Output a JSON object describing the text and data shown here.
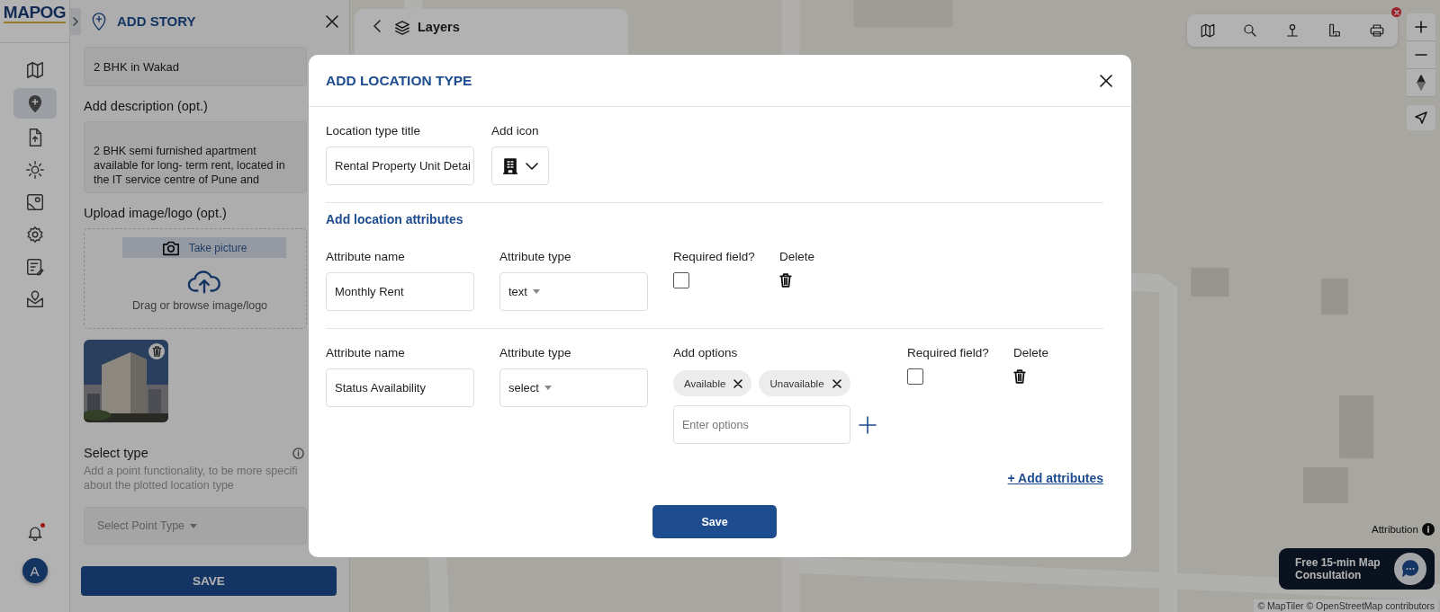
{
  "brand": {
    "logo": "MAPOG"
  },
  "rail": {
    "items": [
      {
        "selected": false
      },
      {
        "selected": true
      },
      {
        "selected": false
      },
      {
        "selected": false
      },
      {
        "selected": false
      },
      {
        "selected": false
      },
      {
        "selected": false
      },
      {
        "selected": false
      }
    ],
    "notifications": {
      "unread": true
    },
    "avatar": "A"
  },
  "story_panel": {
    "title": "ADD STORY",
    "name_value": "2 BHK in Wakad",
    "description_label": "Add description (opt.)",
    "description_value": "2 BHK semi furnished apartment available for long- term rent, located in the IT service centre of Pune and",
    "upload_label": "Upload image/logo (opt.)",
    "take_picture": "Take picture",
    "drop_hint": "Drag or browse image/logo",
    "select_type_label": "Select type",
    "select_type_hint": "Add a point functionality, to be more specifi\nabout the plotted location type",
    "select_placeholder": "Select Point Type",
    "save": "SAVE"
  },
  "layers_panel": {
    "title": "Layers"
  },
  "map": {
    "attribution": "Attribution",
    "consultation": "Free 15-min Map Consultation",
    "copyright": "© MapTiler © OpenStreetMap contributors"
  },
  "modal": {
    "title": "ADD LOCATION TYPE",
    "title_label": "Location type title",
    "title_value": "Rental Property Unit Detai",
    "icon_label": "Add icon",
    "section_title": "Add location attributes",
    "attributes": [
      {
        "kind": "simple",
        "name_label": "Attribute name",
        "name_value": "Monthly Rent",
        "type_label": "Attribute type",
        "type_value": "text",
        "required_label": "Required field?",
        "required": false,
        "delete_label": "Delete"
      },
      {
        "kind": "options",
        "name_label": "Attribute name",
        "name_value": "Status Availability",
        "type_label": "Attribute type",
        "type_value": "select",
        "options_label": "Add options",
        "options": [
          "Available",
          "Unavailable"
        ],
        "options_placeholder": "Enter options",
        "required_label": "Required field?",
        "required": false,
        "delete_label": "Delete"
      }
    ],
    "add_attributes": "+ Add attributes",
    "save": "Save"
  }
}
